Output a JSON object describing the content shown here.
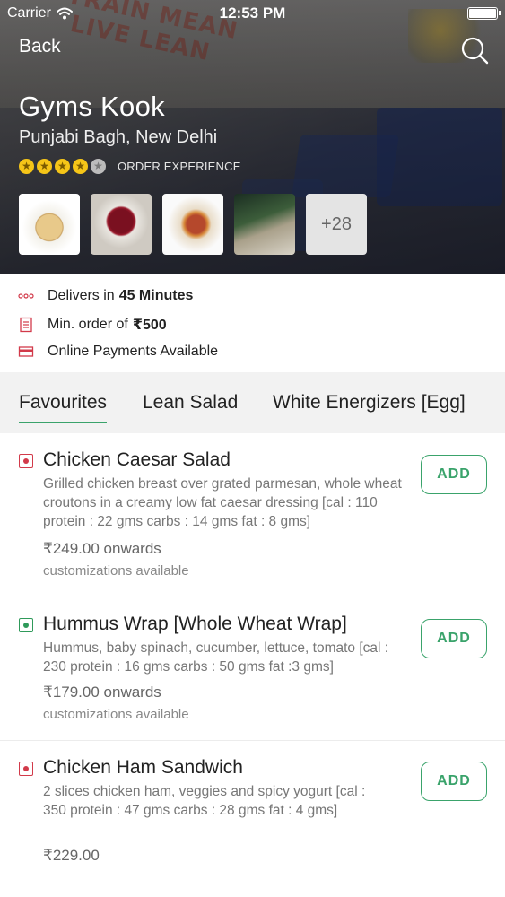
{
  "status_bar": {
    "carrier": "Carrier",
    "time": "12:53 PM"
  },
  "nav": {
    "back_label": "Back",
    "search_icon": "search-icon"
  },
  "restaurant": {
    "name": "Gyms Kook",
    "location": "Punjabi Bagh, New Delhi",
    "rating": {
      "stars_filled": 4,
      "stars_total": 5,
      "label": "ORDER EXPERIENCE"
    },
    "thumbnails_more": "+28"
  },
  "background_text": "TRAIN MEAN\nLIVE LEAN",
  "info": {
    "delivery_prefix": "Delivers in",
    "delivery_time": "45 Minutes",
    "min_order_prefix": "Min. order of",
    "min_order_value": "₹500",
    "payments": "Online Payments Available"
  },
  "tabs": [
    {
      "label": "Favourites",
      "active": true
    },
    {
      "label": "Lean Salad",
      "active": false
    },
    {
      "label": "White Energizers [Egg]",
      "active": false
    }
  ],
  "menu": [
    {
      "type": "non-veg",
      "name": "Chicken Caesar Salad",
      "description": "Grilled chicken breast over grated parmesan, whole wheat croutons in a creamy low fat caesar dressing [cal : 110 protein : 22 gms carbs : 14 gms fat : 8 gms]",
      "price": "₹249.00 onwards",
      "customizations": "customizations available",
      "add_label": "ADD"
    },
    {
      "type": "veg",
      "name": "Hummus Wrap [Whole Wheat Wrap]",
      "description": "Hummus, baby spinach, cucumber, lettuce, tomato [cal : 230 protein : 16 gms carbs : 50 gms fat :3 gms]",
      "price": "₹179.00 onwards",
      "customizations": "customizations available",
      "add_label": "ADD"
    },
    {
      "type": "non-veg",
      "name": "Chicken Ham Sandwich",
      "description": "2 slices chicken ham, veggies and spicy yogurt [cal : 350 protein : 47 gms carbs : 28 gms fat : 4 gms]",
      "price": "₹229.00",
      "customizations": "",
      "add_label": "ADD"
    }
  ],
  "colors": {
    "accent_green": "#3aa36b",
    "non_veg_red": "#d23a4a",
    "veg_green": "#2f9a5a",
    "star_gold": "#f5c518"
  }
}
